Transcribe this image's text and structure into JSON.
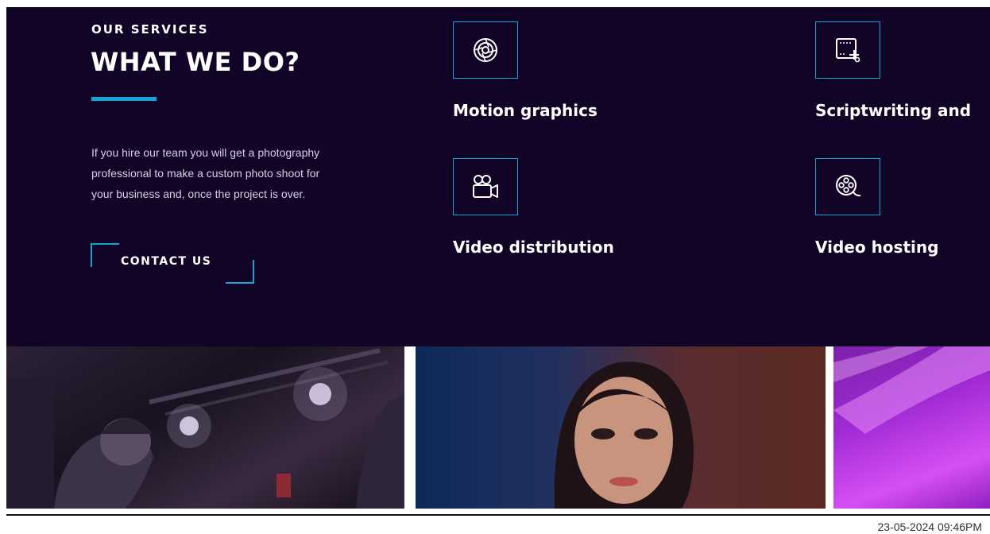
{
  "services_section": {
    "eyebrow": "OUR SERVICES",
    "heading": "WHAT WE DO?",
    "intro_lines": [
      "If you hire our team you will get a photography",
      "professional to make a custom photo shoot for",
      "your business and, once the project is over."
    ],
    "contact_label": "CONTACT US",
    "services": [
      {
        "title": "Motion graphics",
        "icon": "aperture-icon"
      },
      {
        "title": "Scriptwriting and",
        "icon": "storyboard-icon"
      },
      {
        "title": "Video distribution",
        "icon": "video-camera-icon"
      },
      {
        "title": "Video hosting",
        "icon": "film-reel-icon"
      }
    ]
  },
  "gallery": {
    "photos": [
      {
        "icon": "film-crew-photo"
      },
      {
        "icon": "portrait-photo"
      },
      {
        "icon": "purple-light-photo"
      }
    ]
  },
  "footer": {
    "timestamp": "23-05-2024 09:46PM"
  },
  "colors": {
    "background": "#110427",
    "accent": "#13a7d8",
    "text": "#ffffff"
  }
}
